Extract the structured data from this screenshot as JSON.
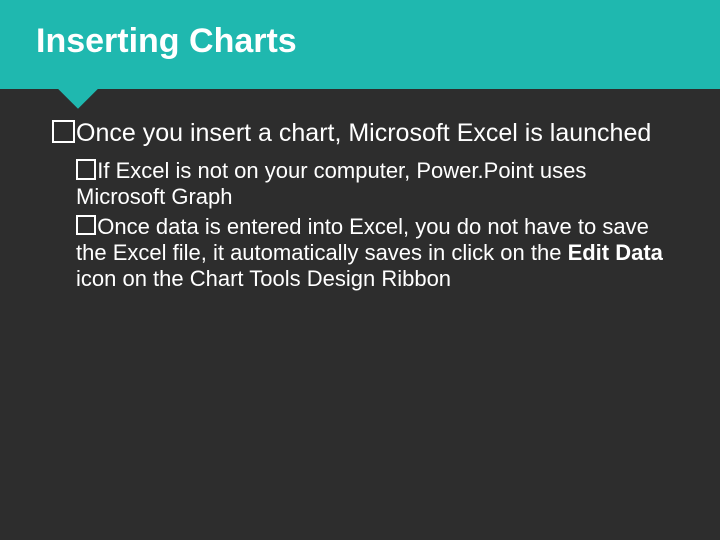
{
  "title": "Inserting Charts",
  "main_bullet": "Once you insert a chart, Microsoft Excel is launched",
  "sub1": "If Excel is not on your computer, Power.Point uses Microsoft Graph",
  "sub2_prefix": "Once data is entered into Excel, you do not have to save the Excel file, it automatically saves in click on the ",
  "sub2_bold": "Edit Data",
  "sub2_suffix": " icon on the Chart Tools Design Ribbon"
}
